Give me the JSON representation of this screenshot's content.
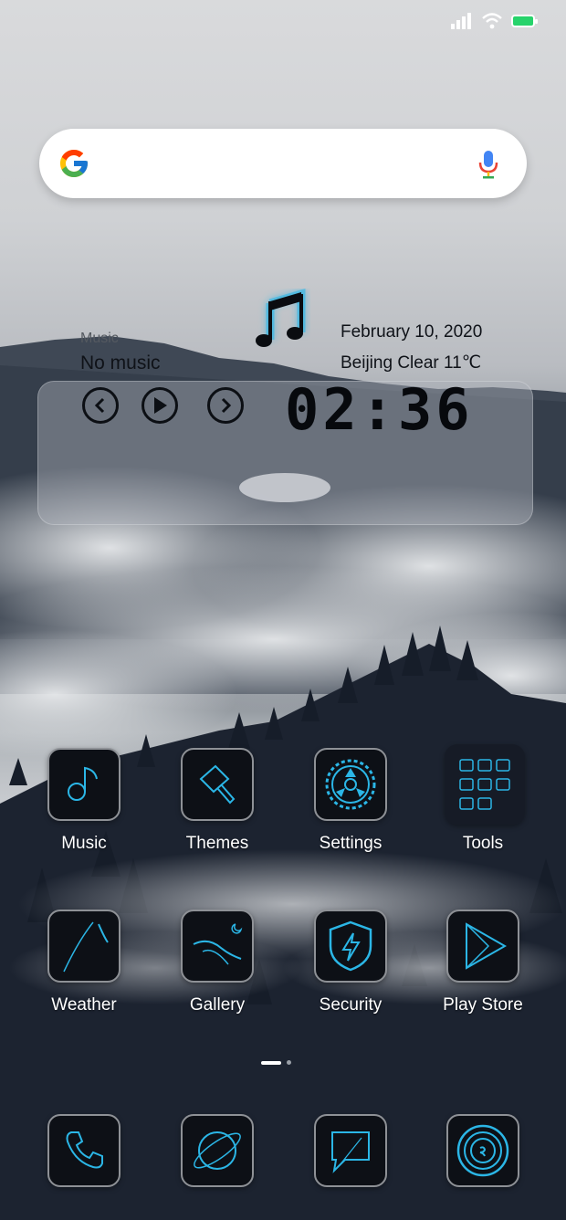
{
  "colors": {
    "accent": "#2bb6e6",
    "battery": "#27d36b"
  },
  "status_bar": {
    "icons": [
      "signal-icon",
      "wifi-icon",
      "battery-icon"
    ]
  },
  "search": {
    "logo": "google-g-icon",
    "mic": "mic-icon"
  },
  "music_widget": {
    "title": "Music",
    "status": "No music",
    "date": "February  10, 2020",
    "weather": "Beijing  Clear  11℃",
    "time": "02:36"
  },
  "apps": [
    {
      "label": "Music",
      "icon": "music-note-icon"
    },
    {
      "label": "Themes",
      "icon": "paintbrush-icon"
    },
    {
      "label": "Settings",
      "icon": "gear-icon"
    },
    {
      "label": "Tools",
      "icon": "folder-icon"
    },
    {
      "label": "Weather",
      "icon": "weather-icon"
    },
    {
      "label": "Gallery",
      "icon": "gallery-icon"
    },
    {
      "label": "Security",
      "icon": "shield-icon"
    },
    {
      "label": "Play Store",
      "icon": "play-store-icon"
    }
  ],
  "dock": [
    {
      "icon": "phone-icon"
    },
    {
      "icon": "browser-icon"
    },
    {
      "icon": "messages-icon"
    },
    {
      "icon": "camera-icon"
    }
  ],
  "page_indicator": {
    "pages": 2,
    "current": 1
  }
}
